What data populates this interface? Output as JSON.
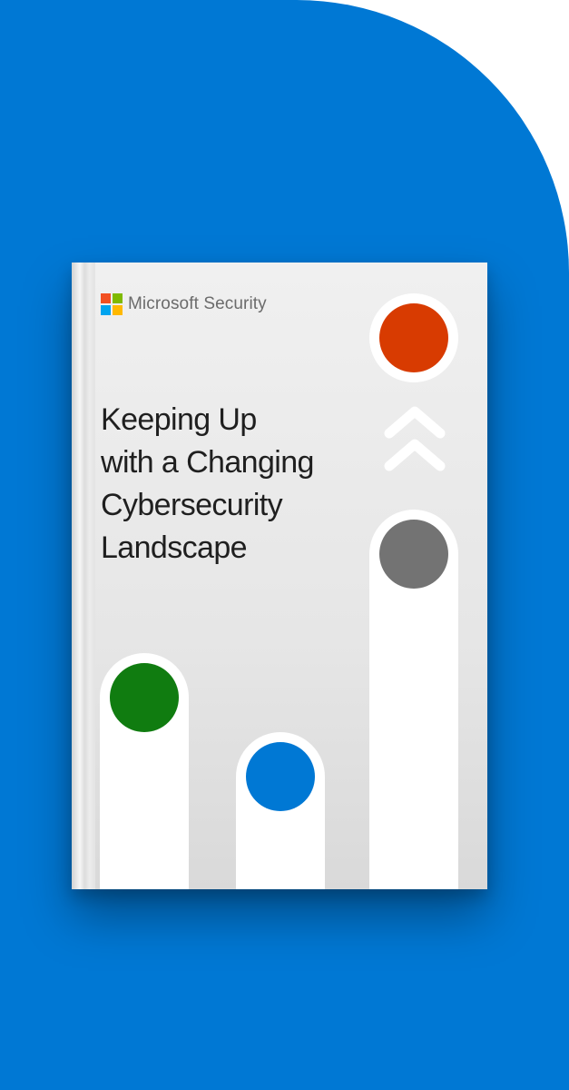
{
  "brand": {
    "name": "Microsoft Security",
    "logo_colors": [
      "#f25022",
      "#7fba00",
      "#00a4ef",
      "#ffb900"
    ]
  },
  "book": {
    "title_lines": [
      "Keeping Up",
      "with a Changing",
      "Cybersecurity",
      "Landscape"
    ]
  },
  "colors": {
    "background": "#0078d4",
    "cover": "#e8e8e8",
    "dot_red": "#d83b01",
    "dot_gray": "#737373",
    "dot_green": "#107c10",
    "dot_blue": "#0078d4"
  },
  "icons": [
    "double-chevron-up-icon"
  ]
}
